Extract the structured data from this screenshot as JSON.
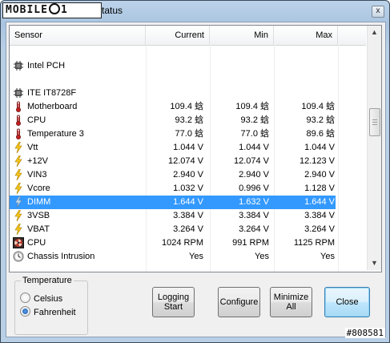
{
  "window": {
    "title": "tatus",
    "logo_text": "MOBILE",
    "logo_suffix": "1",
    "close_glyph": "x"
  },
  "list": {
    "columns": [
      "Sensor",
      "Current",
      "Min",
      "Max"
    ],
    "rows": [
      {
        "type": "blank"
      },
      {
        "type": "group",
        "name": "Intel PCH",
        "icon": "chip-icon"
      },
      {
        "type": "blank"
      },
      {
        "type": "group",
        "name": "ITE IT8728F",
        "icon": "chip-icon"
      },
      {
        "type": "sensor",
        "name": "Motherboard",
        "icon": "thermometer-icon",
        "current": "109.4 蛿",
        "min": "109.4 蛿",
        "max": "109.4 蛿"
      },
      {
        "type": "sensor",
        "name": "CPU",
        "icon": "thermometer-icon",
        "current": "93.2 蛿",
        "min": "93.2 蛿",
        "max": "93.2 蛿"
      },
      {
        "type": "sensor",
        "name": "Temperature 3",
        "icon": "thermometer-icon",
        "current": "77.0 蛿",
        "min": "77.0 蛿",
        "max": "89.6 蛿"
      },
      {
        "type": "sensor",
        "name": "Vtt",
        "icon": "lightning-icon",
        "current": "1.044 V",
        "min": "1.044 V",
        "max": "1.044 V"
      },
      {
        "type": "sensor",
        "name": "+12V",
        "icon": "lightning-icon",
        "current": "12.074 V",
        "min": "12.074 V",
        "max": "12.123 V"
      },
      {
        "type": "sensor",
        "name": "VIN3",
        "icon": "lightning-icon",
        "current": "2.940 V",
        "min": "2.940 V",
        "max": "2.940 V"
      },
      {
        "type": "sensor",
        "name": "Vcore",
        "icon": "lightning-icon",
        "current": "1.032 V",
        "min": "0.996 V",
        "max": "1.128 V"
      },
      {
        "type": "sensor",
        "name": "DIMM",
        "icon": "lightning-icon",
        "current": "1.644 V",
        "min": "1.632 V",
        "max": "1.644 V",
        "selected": true
      },
      {
        "type": "sensor",
        "name": "3VSB",
        "icon": "lightning-icon",
        "current": "3.384 V",
        "min": "3.384 V",
        "max": "3.384 V"
      },
      {
        "type": "sensor",
        "name": "VBAT",
        "icon": "lightning-icon",
        "current": "3.264 V",
        "min": "3.264 V",
        "max": "3.264 V"
      },
      {
        "type": "sensor",
        "name": "CPU",
        "icon": "fan-icon",
        "current": "1024 RPM",
        "min": "991 RPM",
        "max": "1125 RPM"
      },
      {
        "type": "sensor",
        "name": "Chassis Intrusion",
        "icon": "clock-icon",
        "current": "Yes",
        "min": "Yes",
        "max": "Yes"
      }
    ]
  },
  "temperature": {
    "legend": "Temperature",
    "options": [
      {
        "label": "Celsius",
        "checked": false
      },
      {
        "label": "Fahrenheit",
        "checked": true
      }
    ]
  },
  "buttons": {
    "logging": "Logging Start",
    "configure": "Configure",
    "minimize": "Minimize All",
    "close": "Close"
  },
  "watermark": "#808581",
  "colors": {
    "selection": "#3399ff",
    "default_button_border": "#3c7fb1"
  }
}
